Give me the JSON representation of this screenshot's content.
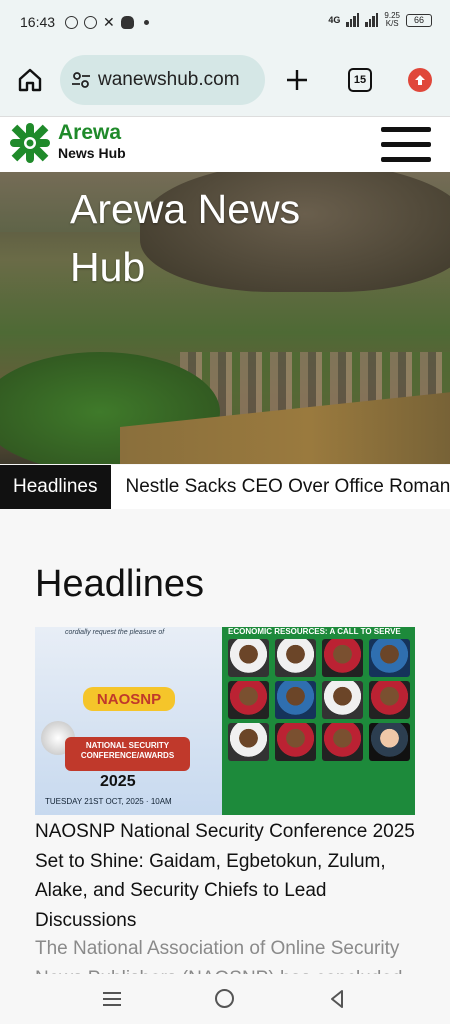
{
  "status_bar": {
    "time": "16:43",
    "network": "4G",
    "speed_value": "9.25",
    "speed_unit": "K/S",
    "battery": "66"
  },
  "browser": {
    "url": "wanewshub.com",
    "tab_count": "15"
  },
  "site": {
    "logo_line1": "Arewa",
    "logo_line2": "News Hub",
    "hero_title": "Arewa News Hub"
  },
  "ticker": {
    "label": "Headlines",
    "item": "Nestle Sacks CEO Over Office Romance"
  },
  "section": {
    "title": "Headlines"
  },
  "article": {
    "image_top_text": "cordially request the pleasure of",
    "image_brand": "NAOSNP",
    "image_banner": "NATIONAL SECURITY CONFERENCE/AWARDS",
    "image_year": "2025",
    "image_footer": "TUESDAY 21ST OCT, 2025 · 10AM",
    "image_right_header": "ECONOMIC RESOURCES: A CALL TO SERVE",
    "title": "NAOSNP National Security Conference 2025 Set to Shine: Gaidam, Egbetokun, Zulum, Alake, and Security Chiefs to Lead Discussions",
    "excerpt": "The National Association of Online Security News Publishers (NAOSNP) has concluded"
  },
  "colors": {
    "brand_green": "#1f8a2a",
    "ticker_label_bg": "#111111",
    "update_badge": "#e0473a"
  }
}
